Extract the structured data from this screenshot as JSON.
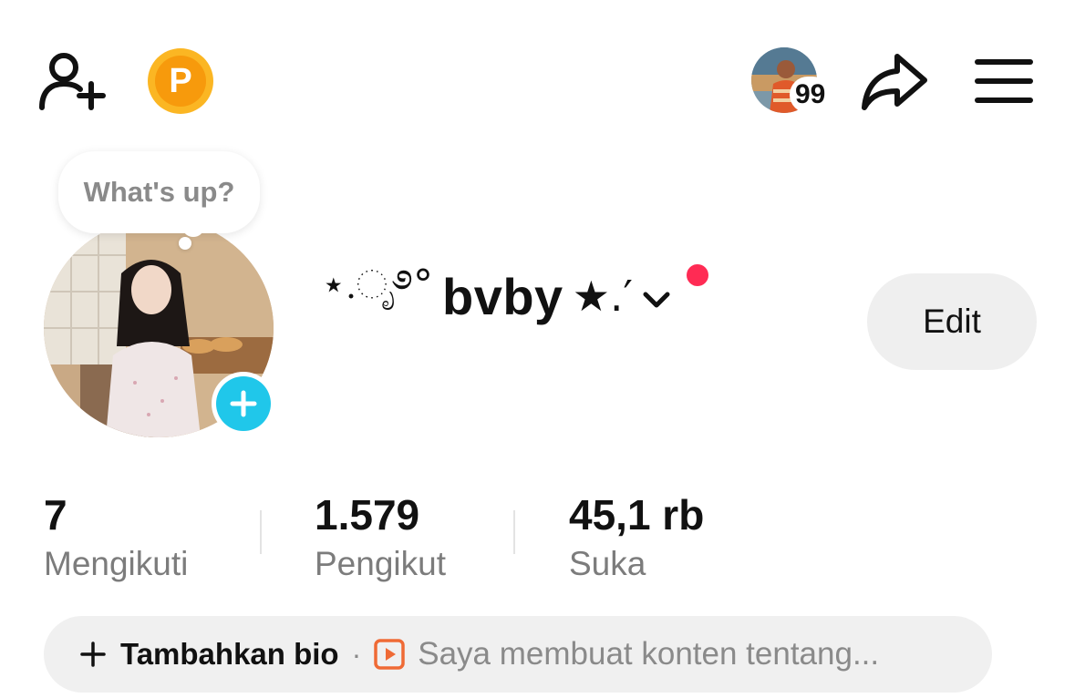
{
  "header": {
    "add_friend_icon": "add-user-icon",
    "points_badge": {
      "letter": "P",
      "color": "#f79a0c"
    },
    "visitor": {
      "count": "99"
    },
    "share_icon": "share-arrow-icon",
    "menu_icon": "hamburger-menu-icon"
  },
  "profile": {
    "status_bubble": "What's up?",
    "name_prefix": "⋆.ೃ࿔°",
    "name": "bvby",
    "name_suffix": "★.′",
    "edit_label": "Edit",
    "notification_color": "#ff2b54"
  },
  "stats": [
    {
      "value": "7",
      "label": "Mengikuti"
    },
    {
      "value": "1.579",
      "label": "Pengikut"
    },
    {
      "value": "45,1 rb",
      "label": "Suka"
    }
  ],
  "bio": {
    "add_label": "Tambahkan bio",
    "separator": "·",
    "hint": "Saya membuat konten tentang..."
  },
  "colors": {
    "accent_add": "#20c7ea",
    "points": "#fbb623",
    "bio_icon": "#ef6a35"
  }
}
